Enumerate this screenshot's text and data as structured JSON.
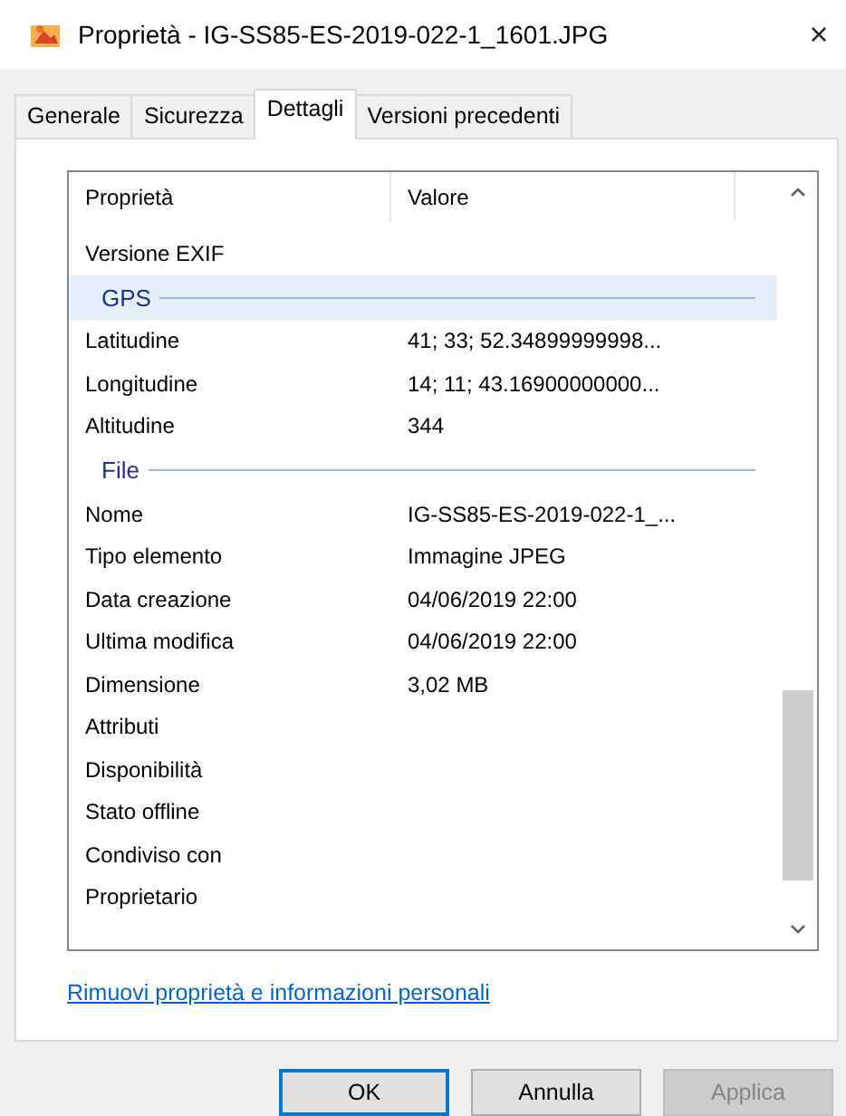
{
  "window": {
    "title": "Proprietà - IG-SS85-ES-2019-022-1_1601.JPG",
    "close": "×"
  },
  "tabs": [
    {
      "label": "Generale",
      "selected": false
    },
    {
      "label": "Sicurezza",
      "selected": false
    },
    {
      "label": "Dettagli",
      "selected": true
    },
    {
      "label": "Versioni precedenti",
      "selected": false
    }
  ],
  "table": {
    "columns": [
      "Proprietà",
      "Valore"
    ],
    "rows": [
      {
        "kind": "property",
        "name": "Versione EXIF",
        "value": ""
      },
      {
        "kind": "group",
        "name": "GPS",
        "selected": true
      },
      {
        "kind": "property",
        "name": "Latitudine",
        "value": "41; 33; 52.34899999998..."
      },
      {
        "kind": "property",
        "name": "Longitudine",
        "value": "14; 11; 43.16900000000..."
      },
      {
        "kind": "property",
        "name": "Altitudine",
        "value": "344"
      },
      {
        "kind": "group",
        "name": "File",
        "selected": false
      },
      {
        "kind": "property",
        "name": "Nome",
        "value": "IG-SS85-ES-2019-022-1_..."
      },
      {
        "kind": "property",
        "name": "Tipo elemento",
        "value": "Immagine JPEG"
      },
      {
        "kind": "property",
        "name": "Data creazione",
        "value": "04/06/2019 22:00"
      },
      {
        "kind": "property",
        "name": "Ultima modifica",
        "value": "04/06/2019 22:00"
      },
      {
        "kind": "property",
        "name": "Dimensione",
        "value": "3,02 MB"
      },
      {
        "kind": "property",
        "name": "Attributi",
        "value": ""
      },
      {
        "kind": "property",
        "name": "Disponibilità",
        "value": ""
      },
      {
        "kind": "property",
        "name": "Stato offline",
        "value": ""
      },
      {
        "kind": "property",
        "name": "Condiviso con",
        "value": ""
      },
      {
        "kind": "property",
        "name": "Proprietario",
        "value": ""
      }
    ]
  },
  "link": "Rimuovi proprietà e informazioni personali",
  "buttons": [
    {
      "label": "OK",
      "default": true,
      "disabled": false
    },
    {
      "label": "Annulla",
      "default": false,
      "disabled": false
    },
    {
      "label": "Applica",
      "default": false,
      "disabled": true
    }
  ]
}
